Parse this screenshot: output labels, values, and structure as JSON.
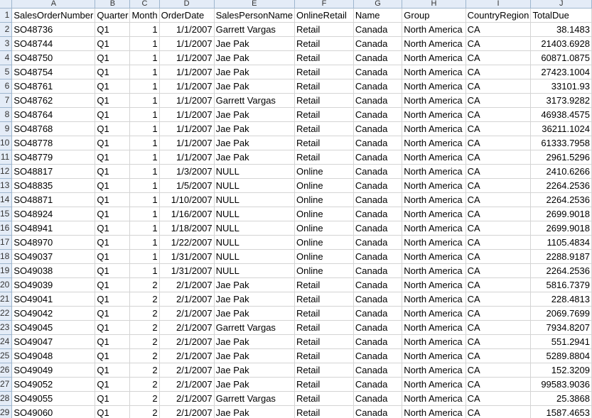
{
  "columns": [
    "A",
    "B",
    "C",
    "D",
    "E",
    "F",
    "G",
    "H",
    "I",
    "J"
  ],
  "header": [
    "SalesOrderNumber",
    "Quarter",
    "Month",
    "OrderDate",
    "SalesPersonName",
    "OnlineRetail",
    "Name",
    "Group",
    "CountryRegion",
    "TotalDue"
  ],
  "rows": [
    [
      "SO48736",
      "Q1",
      "1",
      "1/1/2007",
      "Garrett Vargas",
      "Retail",
      "Canada",
      "North America",
      "CA",
      "38.1483"
    ],
    [
      "SO48744",
      "Q1",
      "1",
      "1/1/2007",
      "Jae Pak",
      "Retail",
      "Canada",
      "North America",
      "CA",
      "21403.6928"
    ],
    [
      "SO48750",
      "Q1",
      "1",
      "1/1/2007",
      "Jae Pak",
      "Retail",
      "Canada",
      "North America",
      "CA",
      "60871.0875"
    ],
    [
      "SO48754",
      "Q1",
      "1",
      "1/1/2007",
      "Jae Pak",
      "Retail",
      "Canada",
      "North America",
      "CA",
      "27423.1004"
    ],
    [
      "SO48761",
      "Q1",
      "1",
      "1/1/2007",
      "Jae Pak",
      "Retail",
      "Canada",
      "North America",
      "CA",
      "33101.93"
    ],
    [
      "SO48762",
      "Q1",
      "1",
      "1/1/2007",
      "Garrett Vargas",
      "Retail",
      "Canada",
      "North America",
      "CA",
      "3173.9282"
    ],
    [
      "SO48764",
      "Q1",
      "1",
      "1/1/2007",
      "Jae Pak",
      "Retail",
      "Canada",
      "North America",
      "CA",
      "46938.4575"
    ],
    [
      "SO48768",
      "Q1",
      "1",
      "1/1/2007",
      "Jae Pak",
      "Retail",
      "Canada",
      "North America",
      "CA",
      "36211.1024"
    ],
    [
      "SO48778",
      "Q1",
      "1",
      "1/1/2007",
      "Jae Pak",
      "Retail",
      "Canada",
      "North America",
      "CA",
      "61333.7958"
    ],
    [
      "SO48779",
      "Q1",
      "1",
      "1/1/2007",
      "Jae Pak",
      "Retail",
      "Canada",
      "North America",
      "CA",
      "2961.5296"
    ],
    [
      "SO48817",
      "Q1",
      "1",
      "1/3/2007",
      "NULL",
      "Online",
      "Canada",
      "North America",
      "CA",
      "2410.6266"
    ],
    [
      "SO48835",
      "Q1",
      "1",
      "1/5/2007",
      "NULL",
      "Online",
      "Canada",
      "North America",
      "CA",
      "2264.2536"
    ],
    [
      "SO48871",
      "Q1",
      "1",
      "1/10/2007",
      "NULL",
      "Online",
      "Canada",
      "North America",
      "CA",
      "2264.2536"
    ],
    [
      "SO48924",
      "Q1",
      "1",
      "1/16/2007",
      "NULL",
      "Online",
      "Canada",
      "North America",
      "CA",
      "2699.9018"
    ],
    [
      "SO48941",
      "Q1",
      "1",
      "1/18/2007",
      "NULL",
      "Online",
      "Canada",
      "North America",
      "CA",
      "2699.9018"
    ],
    [
      "SO48970",
      "Q1",
      "1",
      "1/22/2007",
      "NULL",
      "Online",
      "Canada",
      "North America",
      "CA",
      "1105.4834"
    ],
    [
      "SO49037",
      "Q1",
      "1",
      "1/31/2007",
      "NULL",
      "Online",
      "Canada",
      "North America",
      "CA",
      "2288.9187"
    ],
    [
      "SO49038",
      "Q1",
      "1",
      "1/31/2007",
      "NULL",
      "Online",
      "Canada",
      "North America",
      "CA",
      "2264.2536"
    ],
    [
      "SO49039",
      "Q1",
      "2",
      "2/1/2007",
      "Jae Pak",
      "Retail",
      "Canada",
      "North America",
      "CA",
      "5816.7379"
    ],
    [
      "SO49041",
      "Q1",
      "2",
      "2/1/2007",
      "Jae Pak",
      "Retail",
      "Canada",
      "North America",
      "CA",
      "228.4813"
    ],
    [
      "SO49042",
      "Q1",
      "2",
      "2/1/2007",
      "Jae Pak",
      "Retail",
      "Canada",
      "North America",
      "CA",
      "2069.7699"
    ],
    [
      "SO49045",
      "Q1",
      "2",
      "2/1/2007",
      "Garrett Vargas",
      "Retail",
      "Canada",
      "North America",
      "CA",
      "7934.8207"
    ],
    [
      "SO49047",
      "Q1",
      "2",
      "2/1/2007",
      "Jae Pak",
      "Retail",
      "Canada",
      "North America",
      "CA",
      "551.2941"
    ],
    [
      "SO49048",
      "Q1",
      "2",
      "2/1/2007",
      "Jae Pak",
      "Retail",
      "Canada",
      "North America",
      "CA",
      "5289.8804"
    ],
    [
      "SO49049",
      "Q1",
      "2",
      "2/1/2007",
      "Jae Pak",
      "Retail",
      "Canada",
      "North America",
      "CA",
      "152.3209"
    ],
    [
      "SO49052",
      "Q1",
      "2",
      "2/1/2007",
      "Jae Pak",
      "Retail",
      "Canada",
      "North America",
      "CA",
      "99583.9036"
    ],
    [
      "SO49055",
      "Q1",
      "2",
      "2/1/2007",
      "Garrett Vargas",
      "Retail",
      "Canada",
      "North America",
      "CA",
      "25.3868"
    ],
    [
      "SO49060",
      "Q1",
      "2",
      "2/1/2007",
      "Jae Pak",
      "Retail",
      "Canada",
      "North America",
      "CA",
      "1587.4653"
    ]
  ],
  "row_numbers": [
    "1",
    "2",
    "3",
    "4",
    "5",
    "6",
    "7",
    "8",
    "9",
    "10",
    "11",
    "12",
    "13",
    "14",
    "15",
    "16",
    "17",
    "18",
    "19",
    "20",
    "21",
    "22",
    "23",
    "24",
    "25",
    "26",
    "27",
    "28",
    "29"
  ]
}
